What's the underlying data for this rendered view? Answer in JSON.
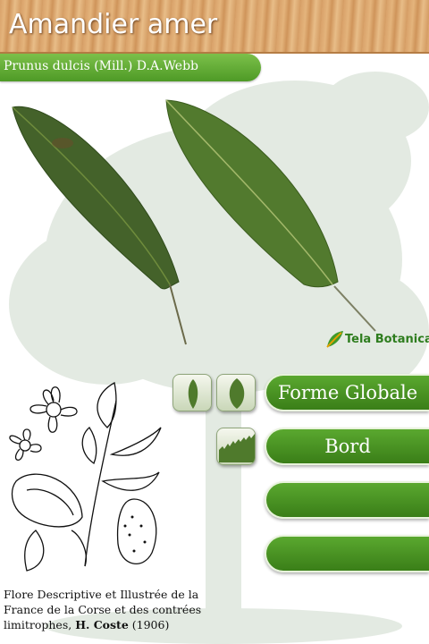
{
  "header": {
    "title": "Amandier amer"
  },
  "subtitle": {
    "scientific_name": "Prunus dulcis (Mill.) D.A.Webb"
  },
  "logo": {
    "text": "Tela Botanica"
  },
  "criteria": [
    {
      "label": "Forme Globale",
      "icons": [
        "leaf-narrow-icon",
        "leaf-oval-icon"
      ]
    },
    {
      "label": "Bord",
      "icons": [
        "leaf-edge-serrated-icon"
      ]
    },
    {
      "label": ""
    },
    {
      "label": ""
    }
  ],
  "caption": {
    "text": "Flore Descriptive et Illustrée de la France de la Corse et des contrées limitrophes,",
    "author": "H. Coste",
    "year": "(1906)"
  },
  "colors": {
    "accent_green": "#4e9a26",
    "header_wood": "#d9a26a"
  }
}
